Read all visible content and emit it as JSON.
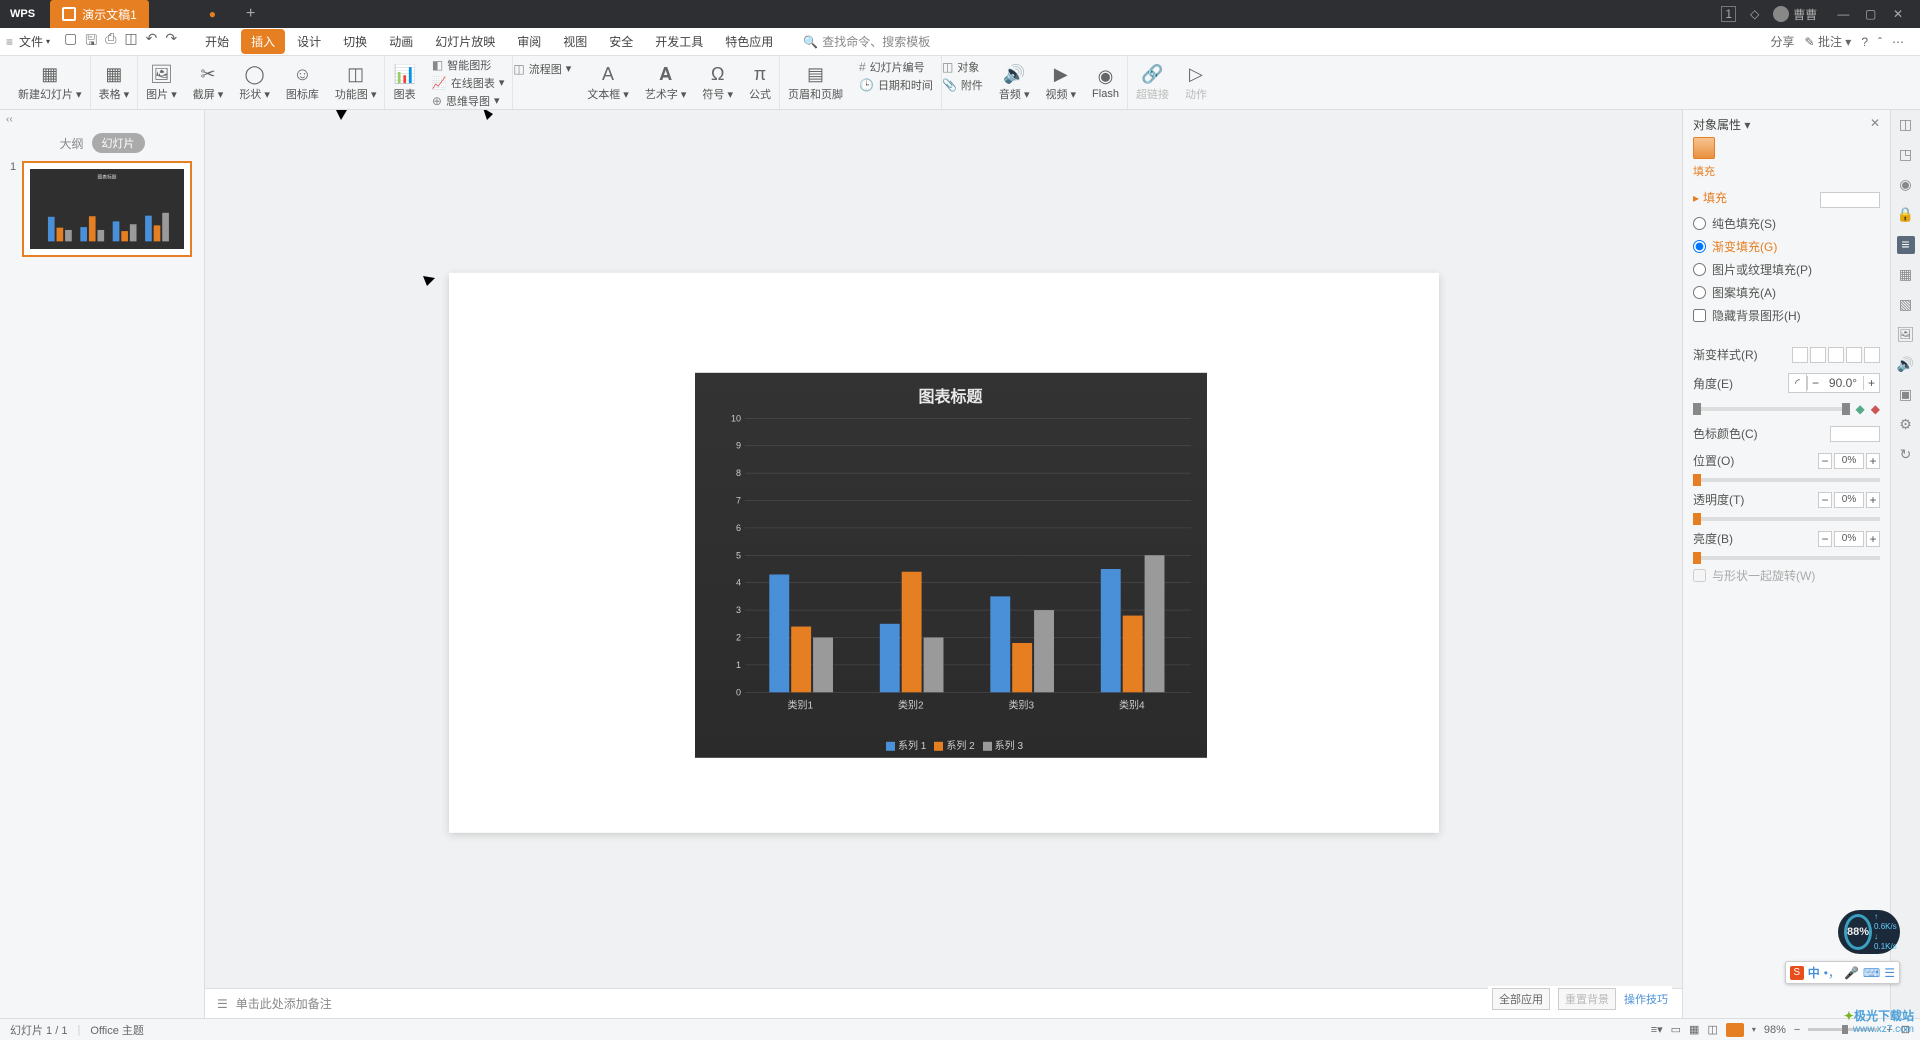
{
  "titlebar": {
    "logo": "WPS",
    "tab_name": "演示文稿1",
    "user": "曹曹"
  },
  "menubar": {
    "file": "文件",
    "tabs": [
      "开始",
      "插入",
      "设计",
      "切换",
      "动画",
      "幻灯片放映",
      "审阅",
      "视图",
      "安全",
      "开发工具",
      "特色应用"
    ],
    "active_tab": 1,
    "search_placeholder": "查找命令、搜索模板",
    "share": "分享",
    "comment": "批注"
  },
  "ribbon": {
    "new_slide": "新建幻灯片",
    "table": "表格",
    "picture": "图片",
    "screenshot": "截屏",
    "shape": "形状",
    "icon_lib": "图标库",
    "function_chart": "功能图",
    "chart": "图表",
    "smart_graphic": "智能图形",
    "online_chart": "在线图表",
    "flowchart": "流程图",
    "mindmap": "思维导图",
    "textbox": "文本框",
    "wordart": "艺术字",
    "symbol": "符号",
    "formula": "公式",
    "header_footer": "页眉和页脚",
    "slide_number": "幻灯片编号",
    "date_time": "日期和时间",
    "object": "对象",
    "attachment": "附件",
    "audio": "音频",
    "video": "视频",
    "flash": "Flash",
    "hyperlink": "超链接",
    "action": "动作"
  },
  "slide_panel": {
    "outline": "大纲",
    "slides": "幻灯片",
    "slide_num": "1"
  },
  "notes": "单击此处添加备注",
  "props": {
    "title": "对象属性",
    "fill_tab": "填充",
    "fill_section": "填充",
    "solid": "纯色填充(S)",
    "gradient": "渐变填充(G)",
    "picture": "图片或纹理填充(P)",
    "pattern": "图案填充(A)",
    "hide_bg": "隐藏背景图形(H)",
    "gradient_style": "渐变样式(R)",
    "angle": "角度(E)",
    "angle_value": "90.0°",
    "color_stop": "色标颜色(C)",
    "position": "位置(O)",
    "position_value": "0%",
    "transparency": "透明度(T)",
    "transparency_value": "0%",
    "brightness": "亮度(B)",
    "brightness_value": "0%",
    "rotate_with_shape": "与形状一起旋转(W)"
  },
  "bottom_tools": {
    "apply_all": "全部应用",
    "reset_bg": "重置背景",
    "tips": "操作技巧"
  },
  "statusbar": {
    "slide_info": "幻灯片 1 / 1",
    "theme": "Office 主题",
    "zoom": "98%"
  },
  "speed": {
    "pct": "88%",
    "up": "0.6K/s",
    "down": "0.1K/s"
  },
  "ime": {
    "label": "中"
  },
  "watermark": {
    "cn": "极光下载站",
    "url": "www.xz7.com"
  },
  "chart_data": {
    "type": "bar",
    "title": "图表标题",
    "categories": [
      "类别1",
      "类别2",
      "类别3",
      "类别4"
    ],
    "series": [
      {
        "name": "系列 1",
        "color": "#4a90d9",
        "values": [
          4.3,
          2.5,
          3.5,
          4.5
        ]
      },
      {
        "name": "系列 2",
        "color": "#e67e22",
        "values": [
          2.4,
          4.4,
          1.8,
          2.8
        ]
      },
      {
        "name": "系列 3",
        "color": "#9a9a9a",
        "values": [
          2.0,
          2.0,
          3.0,
          5.0
        ]
      }
    ],
    "y_ticks": [
      0,
      1,
      2,
      3,
      4,
      5,
      6,
      7,
      8,
      9,
      10
    ],
    "ylim": [
      0,
      10
    ]
  }
}
